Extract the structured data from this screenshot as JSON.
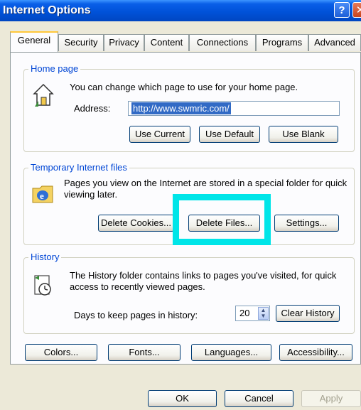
{
  "window": {
    "title": "Internet Options"
  },
  "tabs": [
    "General",
    "Security",
    "Privacy",
    "Content",
    "Connections",
    "Programs",
    "Advanced"
  ],
  "home_page": {
    "legend": "Home page",
    "description": "You can change which page to use for your home page.",
    "address_label": "Address:",
    "address_value": "http://www.swmric.com/",
    "buttons": [
      "Use Current",
      "Use Default",
      "Use Blank"
    ]
  },
  "temp_files": {
    "legend": "Temporary Internet files",
    "description": "Pages you view on the Internet are stored in a special folder for quick viewing later.",
    "buttons": [
      "Delete Cookies...",
      "Delete Files...",
      "Settings..."
    ]
  },
  "history": {
    "legend": "History",
    "description": "The History folder contains links to pages you've visited, for quick access to recently viewed pages.",
    "days_label": "Days to keep pages in history:",
    "days_value": "20",
    "clear_button": "Clear History"
  },
  "bottom_buttons": [
    "Colors...",
    "Fonts...",
    "Languages...",
    "Accessibility..."
  ],
  "dialog_buttons": [
    "OK",
    "Cancel",
    "Apply"
  ],
  "colors": {
    "highlight": "#00e5e8",
    "title_bar": "#0052d9",
    "legend_text": "#0046d5"
  }
}
